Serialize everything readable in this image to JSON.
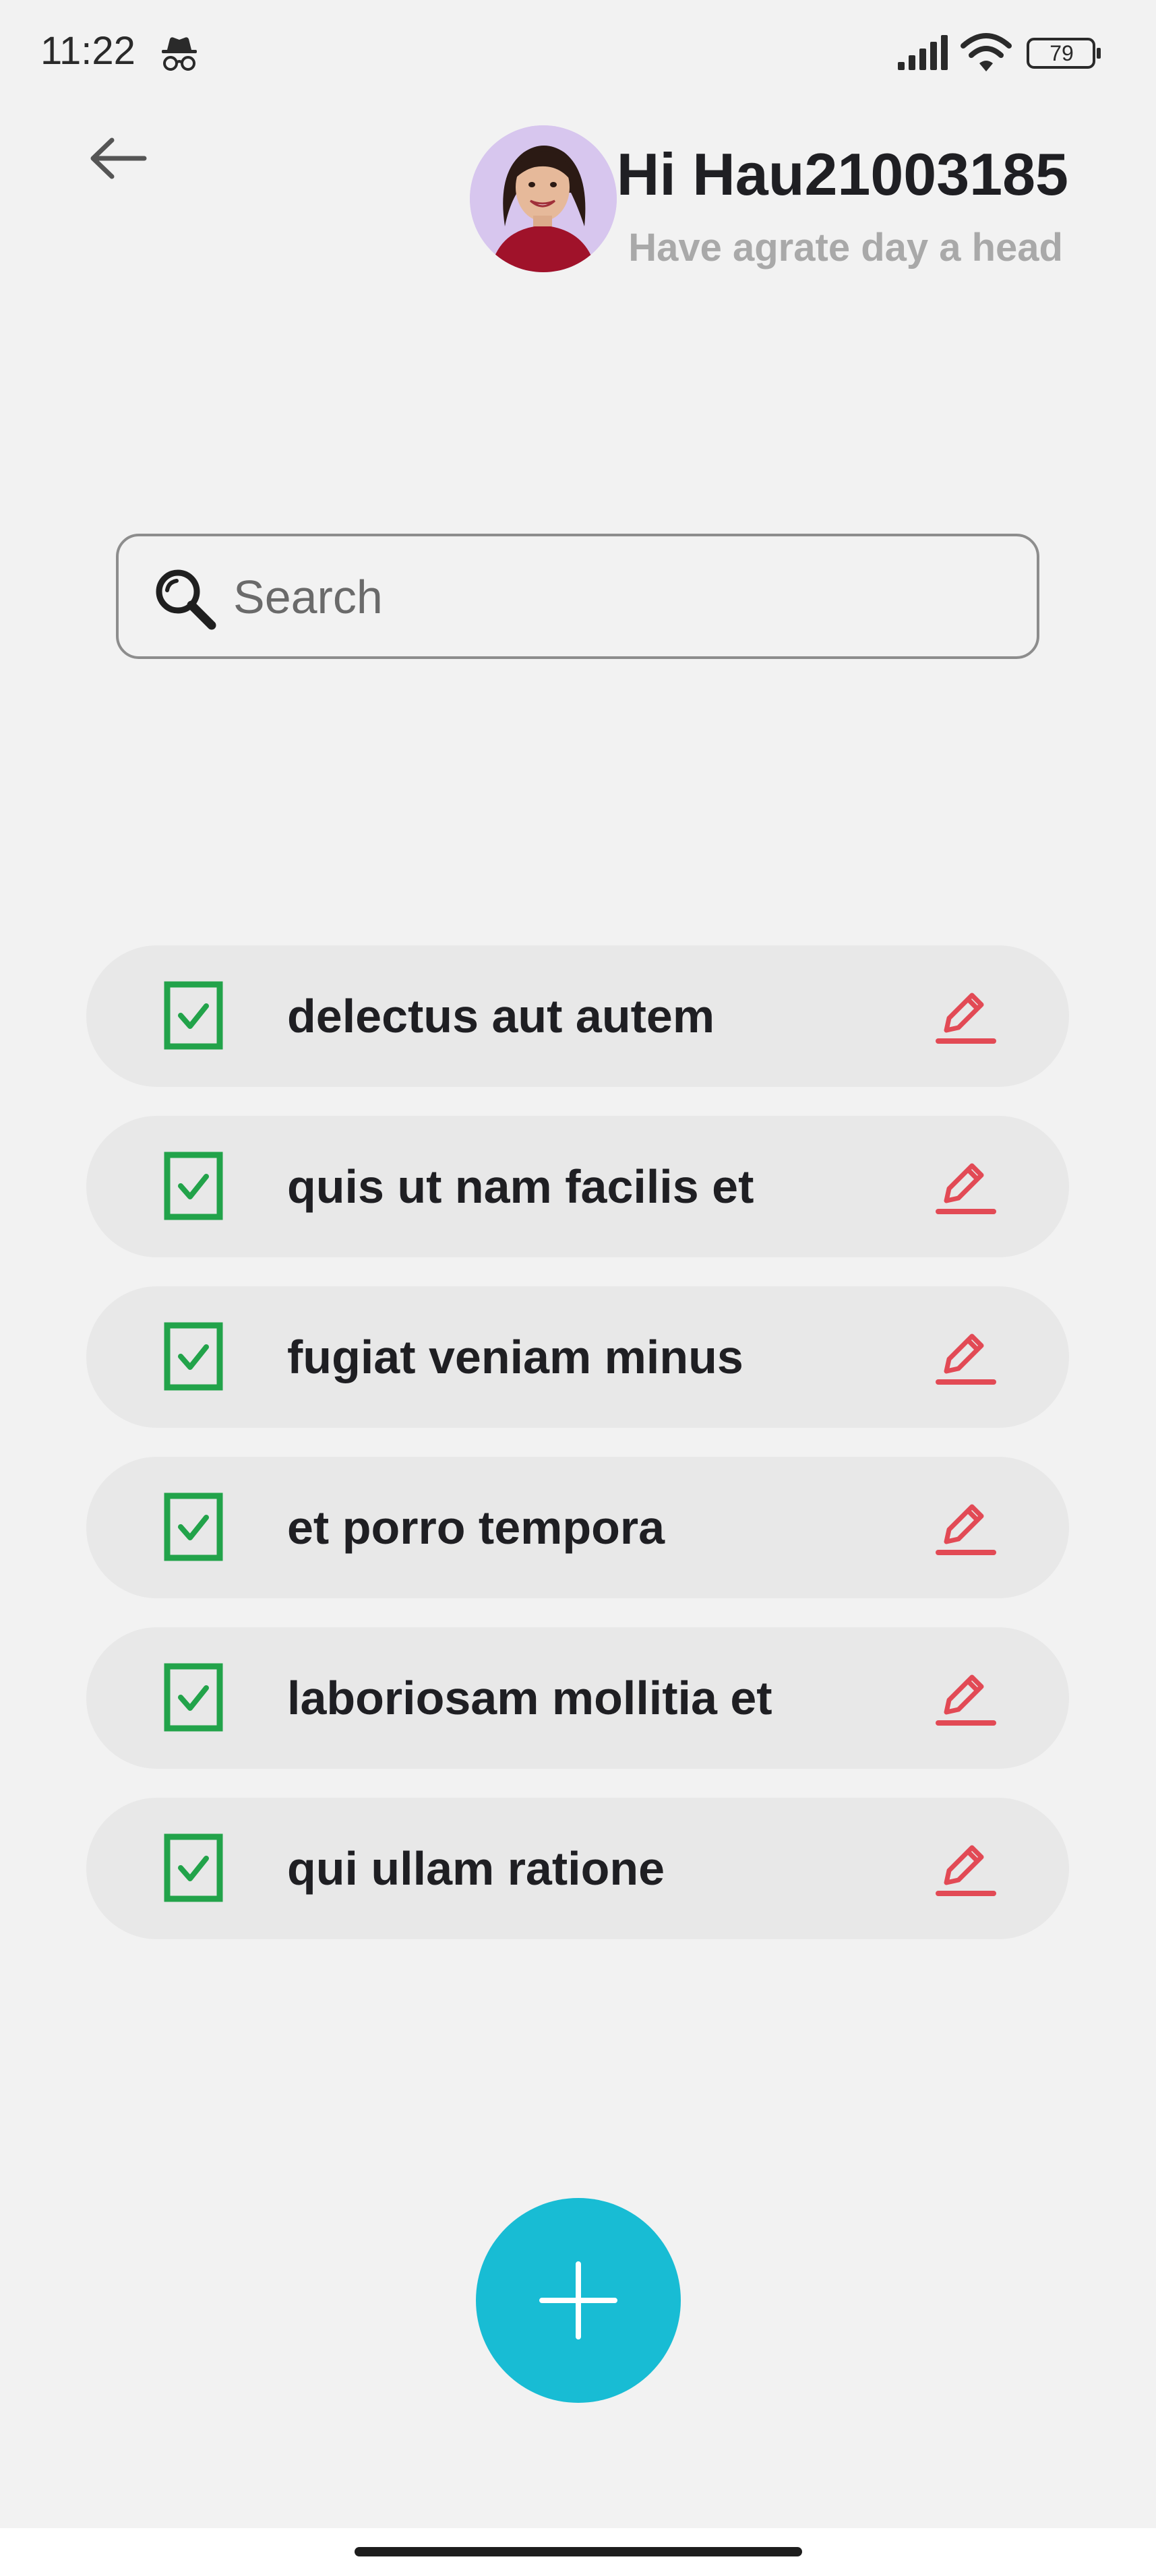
{
  "status_bar": {
    "time": "11:22",
    "battery": "79",
    "icons": [
      "incognito-icon",
      "signal-icon",
      "wifi-icon",
      "battery-icon"
    ]
  },
  "header": {
    "back_icon": "arrow-left-icon",
    "avatar": "user-avatar",
    "greeting": "Hi Hau21003185",
    "subtitle": "Have agrate day a head"
  },
  "search": {
    "placeholder": "Search",
    "value": "",
    "icon": "search-icon"
  },
  "todos": [
    {
      "title": "delectus aut autem",
      "checked": true
    },
    {
      "title": "quis ut nam facilis et",
      "checked": true
    },
    {
      "title": "fugiat veniam minus",
      "checked": true
    },
    {
      "title": "et porro tempora",
      "checked": true
    },
    {
      "title": "laboriosam mollitia et",
      "checked": true
    },
    {
      "title": "qui ullam ratione",
      "checked": true
    }
  ],
  "add_button": {
    "icon": "plus-icon"
  },
  "colors": {
    "background": "#f2f2f2",
    "item_background": "#e8e8e8",
    "check_green": "#22a34a",
    "edit_red": "#e24a55",
    "fab": "#18bcd4",
    "subtitle_gray": "#a9a9a9"
  }
}
